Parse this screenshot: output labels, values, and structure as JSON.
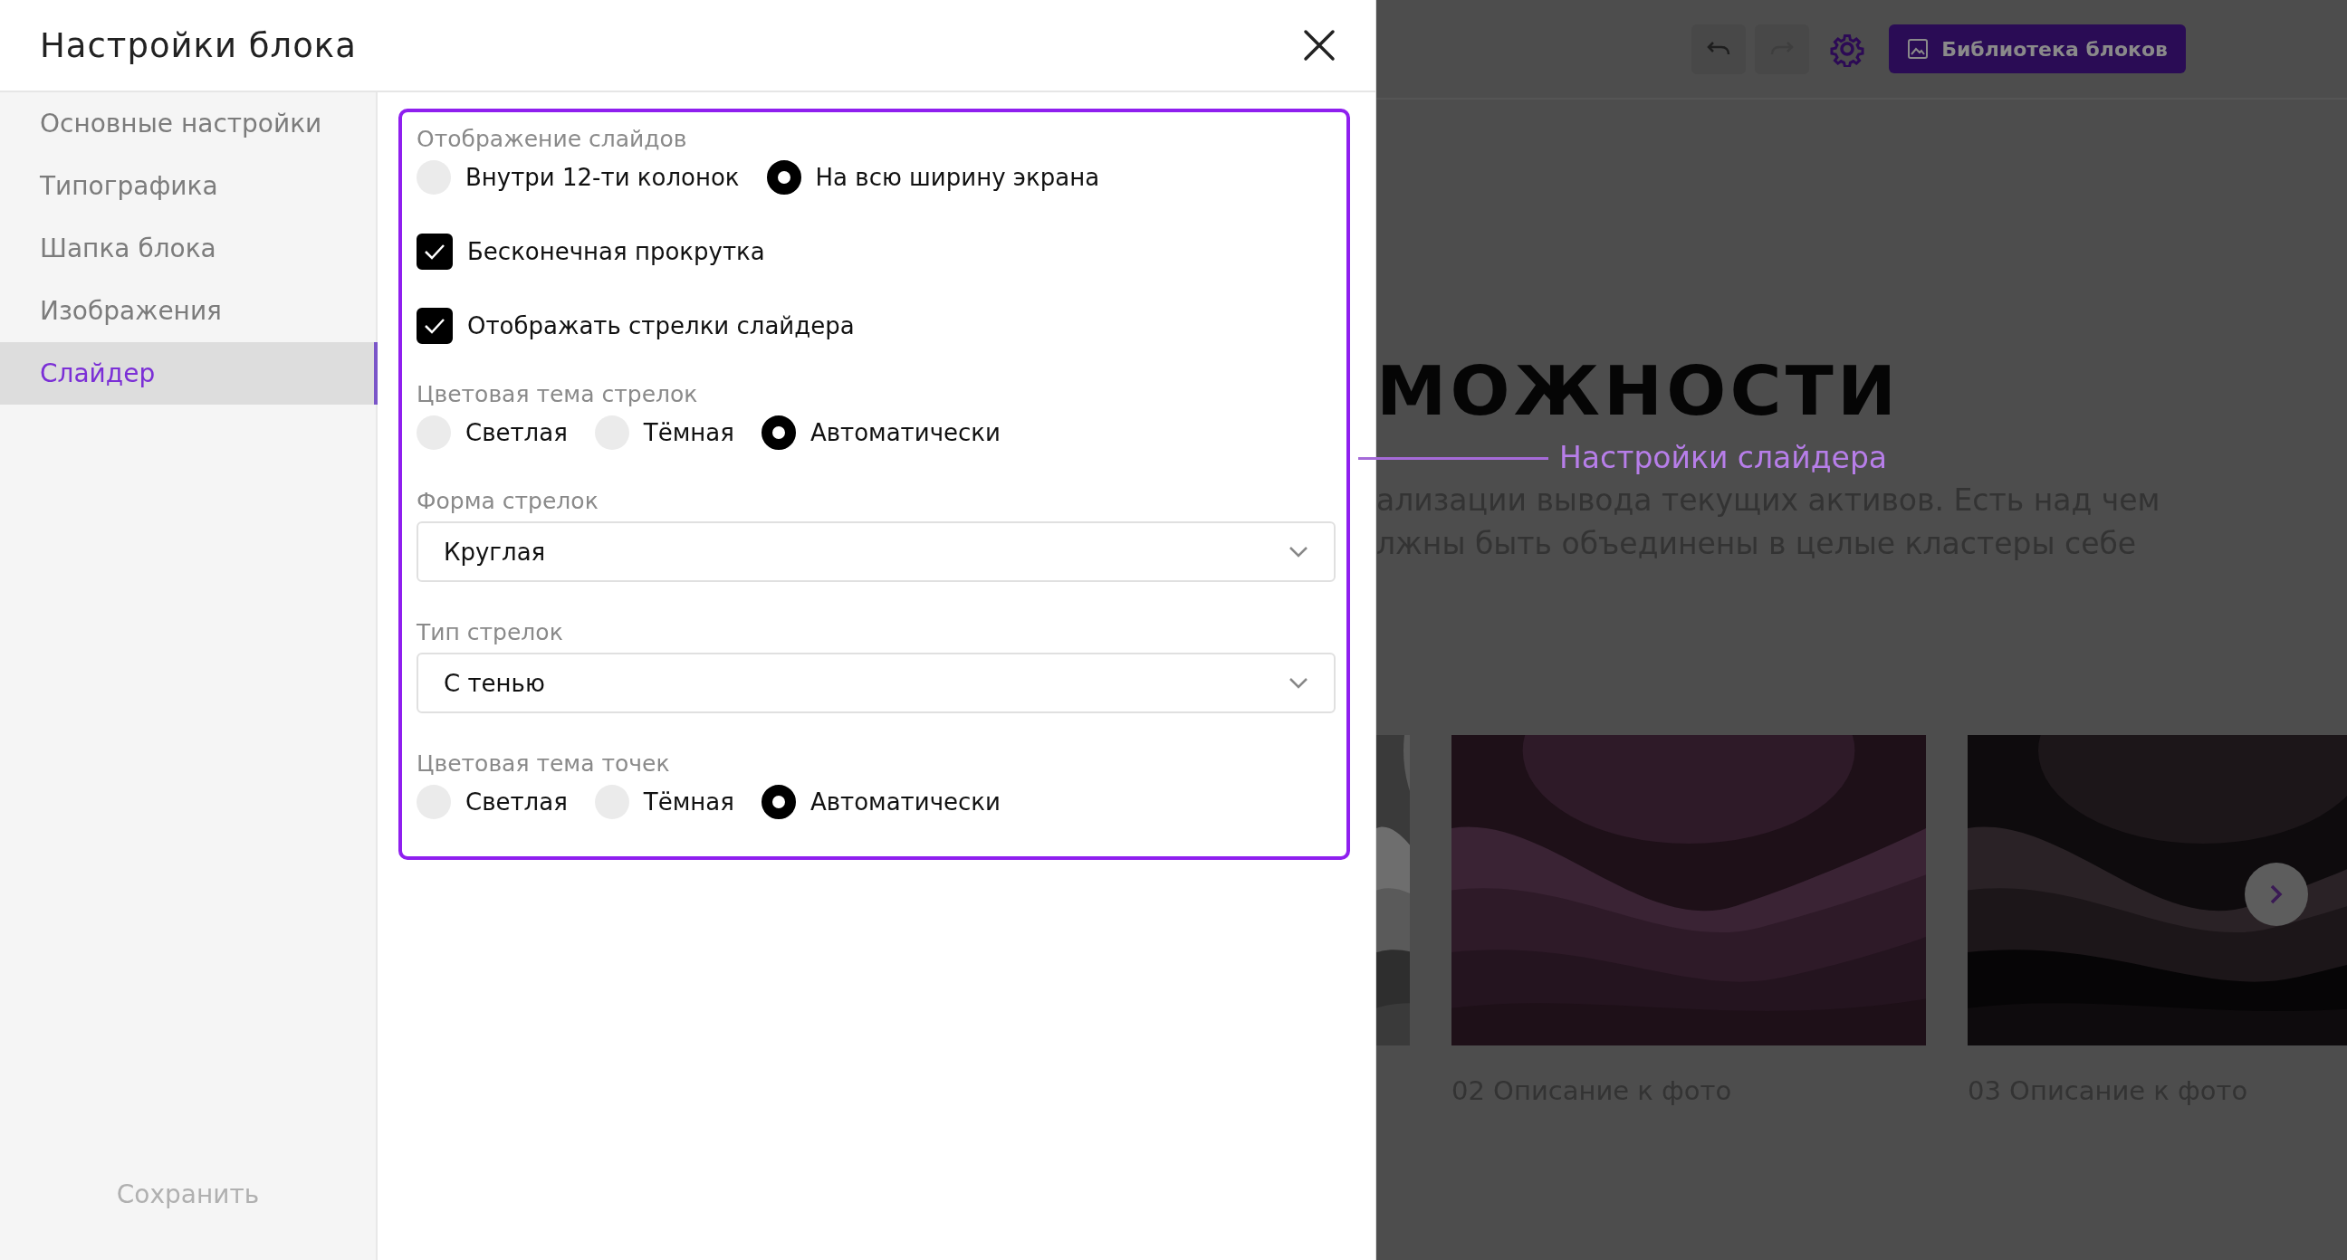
{
  "modal": {
    "title": "Настройки блока",
    "nav": [
      {
        "label": "Основные настройки",
        "selected": false
      },
      {
        "label": "Типографика",
        "selected": false
      },
      {
        "label": "Шапка блока",
        "selected": false
      },
      {
        "label": "Изображения",
        "selected": false
      },
      {
        "label": "Слайдер",
        "selected": true
      }
    ],
    "save_button": {
      "label": "Сохранить",
      "disabled": true
    },
    "groups": [
      {
        "kind": "radio",
        "label": "Отображение слайдов",
        "options": [
          {
            "label": "Внутри 12-ти колонок",
            "selected": false
          },
          {
            "label": "На всю ширину экрана",
            "selected": true
          }
        ]
      },
      {
        "kind": "checkbox",
        "label": "Бесконечная прокрутка",
        "checked": true
      },
      {
        "kind": "checkbox",
        "label": "Отображать стрелки слайдера",
        "checked": true
      },
      {
        "kind": "radio",
        "label": "Цветовая тема стрелок",
        "options": [
          {
            "label": "Светлая",
            "selected": false
          },
          {
            "label": "Тёмная",
            "selected": false
          },
          {
            "label": "Автоматически",
            "selected": true
          }
        ]
      },
      {
        "kind": "select",
        "label": "Форма стрелок",
        "value": "Круглая"
      },
      {
        "kind": "select",
        "label": "Тип стрелок",
        "value": "С тенью"
      },
      {
        "kind": "radio",
        "label": "Цветовая тема точек",
        "options": [
          {
            "label": "Светлая",
            "selected": false
          },
          {
            "label": "Тёмная",
            "selected": false
          },
          {
            "label": "Автоматически",
            "selected": true
          }
        ]
      }
    ]
  },
  "toolbar": {
    "undo": {
      "disabled": false
    },
    "redo": {
      "disabled": true
    },
    "library_button": "Библиотека блоков"
  },
  "preview": {
    "heading": "МОЖНОСТИ",
    "text_lines": [
      "ализации вывода текущих активов. Есть над чем",
      "лжны быть объединены в целые кластеры себе"
    ],
    "slides": [
      {
        "kind": "picture"
      },
      {
        "kind": "picture",
        "caption": "02 Описание к фото"
      },
      {
        "kind": "picture",
        "caption": "03 Описание к фото"
      }
    ]
  },
  "annotation": {
    "text": "Настройки слайдера"
  }
}
